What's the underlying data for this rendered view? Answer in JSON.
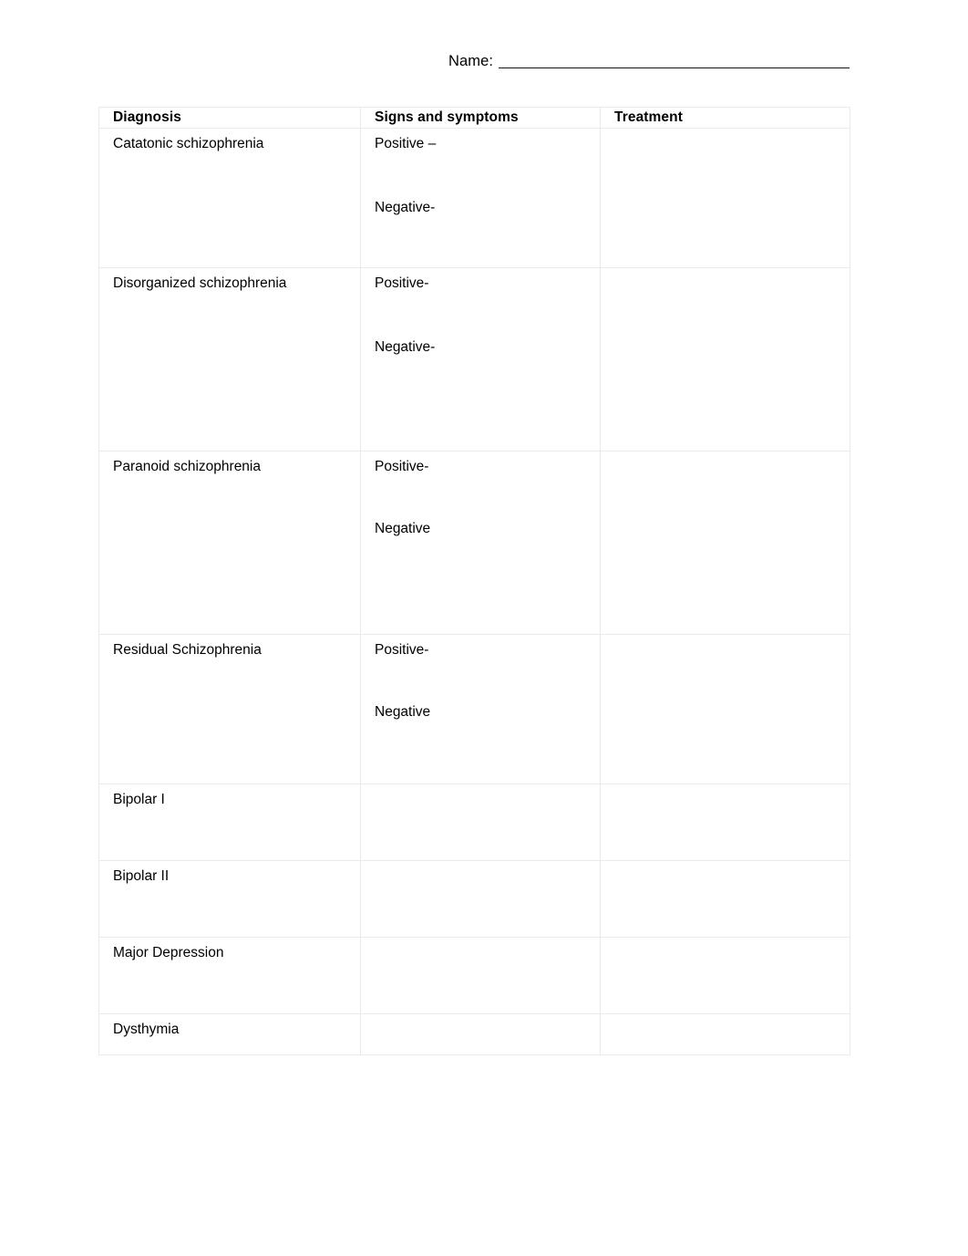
{
  "header": {
    "name_label": "Name:",
    "name_value": ""
  },
  "table": {
    "columns": [
      {
        "key": "diagnosis",
        "label": "Diagnosis"
      },
      {
        "key": "signs",
        "label": "Signs and symptoms"
      },
      {
        "key": "treatment",
        "label": "Treatment"
      }
    ],
    "rows": [
      {
        "diagnosis": "Catatonic schizophrenia",
        "signs_positive": "Positive –",
        "signs_negative": "Negative-",
        "treatment": ""
      },
      {
        "diagnosis": "Disorganized schizophrenia",
        "signs_positive": "Positive-",
        "signs_negative": "Negative-",
        "treatment": ""
      },
      {
        "diagnosis": "Paranoid schizophrenia",
        "signs_positive": "Positive-",
        "signs_negative": "Negative",
        "treatment": ""
      },
      {
        "diagnosis": "Residual Schizophrenia",
        "signs_positive": "Positive-",
        "signs_negative": "Negative",
        "treatment": ""
      },
      {
        "diagnosis": "Bipolar I",
        "signs_positive": "",
        "signs_negative": "",
        "treatment": ""
      },
      {
        "diagnosis": "Bipolar II",
        "signs_positive": "",
        "signs_negative": "",
        "treatment": ""
      },
      {
        "diagnosis": "Major Depression",
        "signs_positive": "",
        "signs_negative": "",
        "treatment": ""
      },
      {
        "diagnosis": "Dysthymia",
        "signs_positive": "",
        "signs_negative": "",
        "treatment": ""
      }
    ]
  },
  "colors": {
    "page_background": "#ffffff",
    "text": "#000000",
    "table_border": "#eaeaea",
    "rule": "#141414"
  }
}
